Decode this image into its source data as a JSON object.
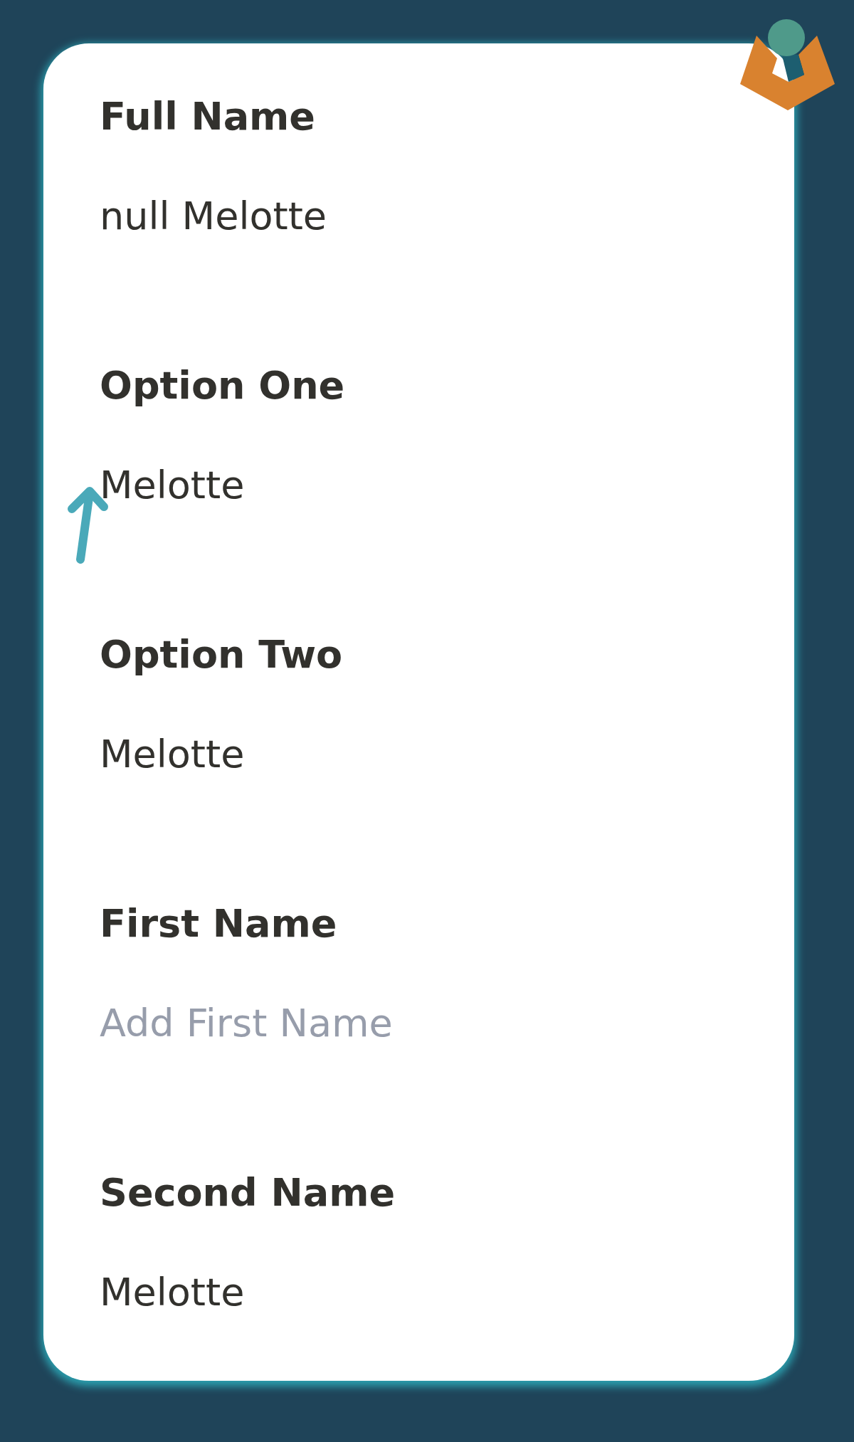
{
  "fields": [
    {
      "label": "Full Name",
      "value": "null Melotte"
    },
    {
      "label": "Option One",
      "value": "Melotte"
    },
    {
      "label": "Option Two",
      "value": "Melotte"
    },
    {
      "label": "First Name",
      "placeholder": "Add First Name"
    },
    {
      "label": "Second Name",
      "value": "Melotte"
    }
  ]
}
